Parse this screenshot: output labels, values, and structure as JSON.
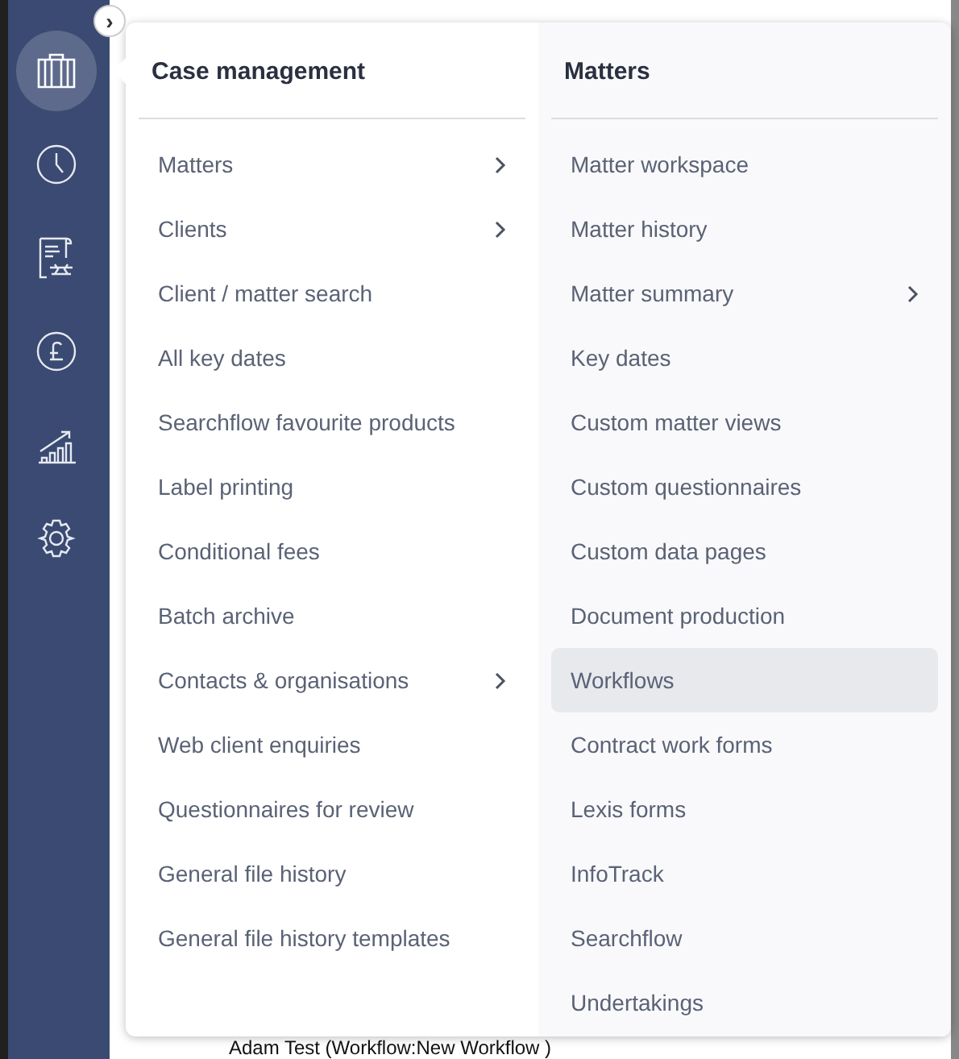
{
  "toggle": {
    "label": "›"
  },
  "sidebar": {
    "items": [
      {
        "kind": "briefcase",
        "selected": true
      },
      {
        "kind": "clock",
        "selected": false
      },
      {
        "kind": "document",
        "selected": false
      },
      {
        "kind": "pound",
        "selected": false
      },
      {
        "kind": "chart",
        "selected": false
      },
      {
        "kind": "gear",
        "selected": false
      }
    ]
  },
  "menu": {
    "columns": [
      {
        "title": "Case management",
        "items": [
          {
            "label": "Matters",
            "has_submenu": true,
            "selected": false
          },
          {
            "label": "Clients",
            "has_submenu": true,
            "selected": false
          },
          {
            "label": "Client / matter search",
            "has_submenu": false,
            "selected": false
          },
          {
            "label": "All key dates",
            "has_submenu": false,
            "selected": false
          },
          {
            "label": "Searchflow favourite products",
            "has_submenu": false,
            "selected": false
          },
          {
            "label": "Label printing",
            "has_submenu": false,
            "selected": false
          },
          {
            "label": "Conditional fees",
            "has_submenu": false,
            "selected": false
          },
          {
            "label": "Batch archive",
            "has_submenu": false,
            "selected": false
          },
          {
            "label": "Contacts & organisations",
            "has_submenu": true,
            "selected": false
          },
          {
            "label": "Web client enquiries",
            "has_submenu": false,
            "selected": false
          },
          {
            "label": "Questionnaires for review",
            "has_submenu": false,
            "selected": false
          },
          {
            "label": "General file history",
            "has_submenu": false,
            "selected": false
          },
          {
            "label": "General file history templates",
            "has_submenu": false,
            "selected": false
          }
        ]
      },
      {
        "title": "Matters",
        "items": [
          {
            "label": "Matter workspace",
            "has_submenu": false,
            "selected": false
          },
          {
            "label": "Matter history",
            "has_submenu": false,
            "selected": false
          },
          {
            "label": "Matter summary",
            "has_submenu": true,
            "selected": false
          },
          {
            "label": "Key dates",
            "has_submenu": false,
            "selected": false
          },
          {
            "label": "Custom matter views",
            "has_submenu": false,
            "selected": false
          },
          {
            "label": "Custom questionnaires",
            "has_submenu": false,
            "selected": false
          },
          {
            "label": "Custom data pages",
            "has_submenu": false,
            "selected": false
          },
          {
            "label": "Document production",
            "has_submenu": false,
            "selected": false
          },
          {
            "label": "Workflows",
            "has_submenu": false,
            "selected": true
          },
          {
            "label": "Contract work forms",
            "has_submenu": false,
            "selected": false
          },
          {
            "label": "Lexis forms",
            "has_submenu": false,
            "selected": false
          },
          {
            "label": "InfoTrack",
            "has_submenu": false,
            "selected": false
          },
          {
            "label": "Searchflow",
            "has_submenu": false,
            "selected": false
          },
          {
            "label": "Undertakings",
            "has_submenu": false,
            "selected": false
          }
        ]
      }
    ]
  },
  "background": {
    "row_text": "Adam Test (Workflow:New Workflow )"
  }
}
